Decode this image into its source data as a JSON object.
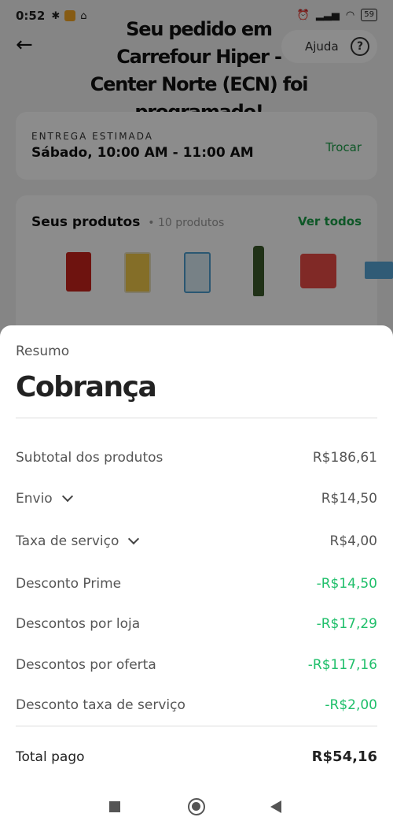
{
  "status_bar": {
    "time": "0:52",
    "battery": "59"
  },
  "header": {
    "title": "Seu pedido em Carrefour Hiper - Center Norte (ECN) foi programado!",
    "help_label": "Ajuda"
  },
  "delivery": {
    "label": "ENTREGA ESTIMADA",
    "value": "Sábado, 10:00 AM - 11:00 AM",
    "change_label": "Trocar"
  },
  "products": {
    "title": "Seus produtos",
    "count": "• 10 produtos",
    "view_all": "Ver todos"
  },
  "summary": {
    "kicker": "Resumo",
    "title": "Cobrança",
    "rows": [
      {
        "label": "Subtotal dos produtos",
        "value": "R$186,61"
      },
      {
        "label": "Envio",
        "value": "R$14,50"
      },
      {
        "label": "Taxa de serviço",
        "value": "R$4,00"
      },
      {
        "label": "Desconto Prime",
        "value": "-R$14,50"
      },
      {
        "label": "Descontos por loja",
        "value": "-R$17,29"
      },
      {
        "label": "Descontos por oferta",
        "value": "-R$117,16"
      },
      {
        "label": "Desconto taxa de serviço",
        "value": "-R$2,00"
      }
    ],
    "total_label": "Total pago",
    "total_value": "R$54,16"
  },
  "colors": {
    "green": "#1fbf6a",
    "link_green": "#1a9e48"
  }
}
